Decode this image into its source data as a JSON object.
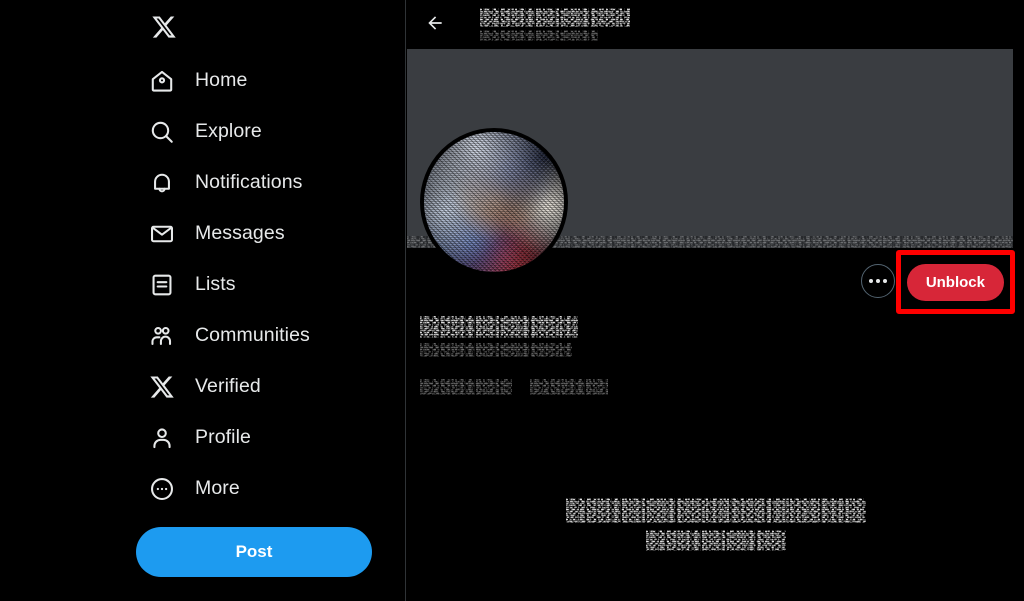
{
  "app": {
    "name": "X",
    "logo_icon": "x-logo-icon"
  },
  "sidebar": {
    "items": [
      {
        "label": "Home",
        "icon": "home-icon"
      },
      {
        "label": "Explore",
        "icon": "search-icon"
      },
      {
        "label": "Notifications",
        "icon": "bell-icon"
      },
      {
        "label": "Messages",
        "icon": "envelope-icon"
      },
      {
        "label": "Lists",
        "icon": "list-icon"
      },
      {
        "label": "Communities",
        "icon": "communities-icon"
      },
      {
        "label": "Verified",
        "icon": "x-logo-icon"
      },
      {
        "label": "Profile",
        "icon": "person-icon"
      },
      {
        "label": "More",
        "icon": "more-circle-icon"
      }
    ],
    "post_button": {
      "label": "Post",
      "color": "#1d9bf0"
    }
  },
  "header": {
    "back_icon": "back-arrow-icon",
    "title": "[redacted]",
    "subtitle": "[redacted]"
  },
  "profile": {
    "banner_color": "#3a3d41",
    "avatar": "[redacted profile photo]",
    "display_name": "[redacted]",
    "handle": "[redacted]",
    "meta_left": "[redacted]",
    "meta_right": "[redacted]",
    "more_button": {
      "label": "More options",
      "icon": "more-dots-icon"
    },
    "unblock_button": {
      "label": "Unblock",
      "color": "#d72638"
    },
    "highlight": {
      "color": "#ff0000",
      "target": "Unblock"
    }
  },
  "empty_state": {
    "line1": "[redacted]",
    "line2": "[redacted]"
  }
}
